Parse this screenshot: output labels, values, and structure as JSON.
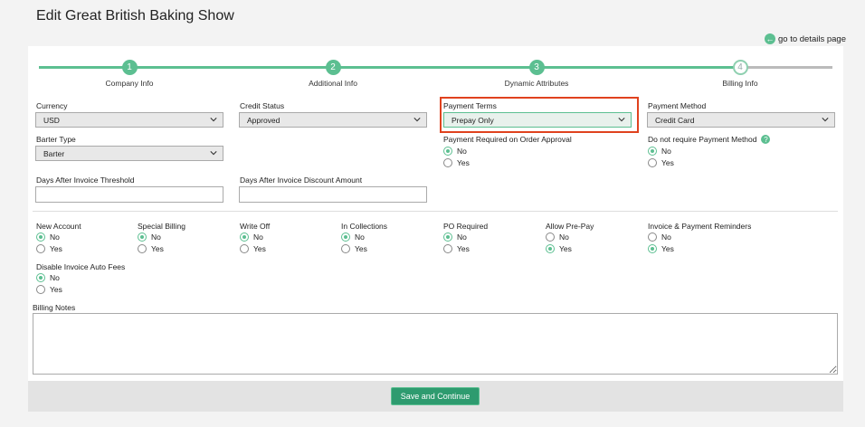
{
  "page_title": "Edit Great British Baking Show",
  "details_link": "go to details page",
  "steps": [
    {
      "number": "1",
      "label": "Company Info",
      "done": true
    },
    {
      "number": "2",
      "label": "Additional Info",
      "done": true
    },
    {
      "number": "3",
      "label": "Dynamic Attributes",
      "done": true
    },
    {
      "number": "4",
      "label": "Billing Info",
      "done": false
    }
  ],
  "fields": {
    "currency": {
      "label": "Currency",
      "value": "USD"
    },
    "credit_status": {
      "label": "Credit Status",
      "value": "Approved"
    },
    "payment_terms": {
      "label": "Payment Terms",
      "value": "Prepay Only"
    },
    "payment_method": {
      "label": "Payment Method",
      "value": "Credit Card"
    },
    "barter_type": {
      "label": "Barter Type",
      "value": "Barter"
    },
    "payment_required": {
      "label": "Payment Required on Order Approval"
    },
    "no_payment_method": {
      "label": "Do not require Payment Method"
    },
    "days_threshold": {
      "label": "Days After Invoice Threshold",
      "value": ""
    },
    "days_discount": {
      "label": "Days After Invoice Discount Amount",
      "value": ""
    }
  },
  "radio_groups": {
    "payment_required": {
      "selected": "No"
    },
    "no_payment_method": {
      "selected": "No"
    },
    "new_account": {
      "label": "New Account",
      "selected": "No"
    },
    "special_billing": {
      "label": "Special Billing",
      "selected": "No"
    },
    "write_off": {
      "label": "Write Off",
      "selected": "No"
    },
    "in_collections": {
      "label": "In Collections",
      "selected": "No"
    },
    "po_required": {
      "label": "PO Required",
      "selected": "No"
    },
    "allow_prepay": {
      "label": "Allow Pre-Pay",
      "selected": "Yes"
    },
    "reminders": {
      "label": "Invoice & Payment Reminders",
      "selected": "Yes"
    },
    "disable_auto_fees": {
      "label": "Disable Invoice Auto Fees",
      "selected": "No"
    }
  },
  "options": {
    "no": "No",
    "yes": "Yes"
  },
  "billing_notes": {
    "label": "Billing Notes",
    "value": ""
  },
  "save_button": "Save and Continue",
  "colors": {
    "accent": "#5cbf91",
    "button": "#2e9b6f",
    "highlight": "#e0421e"
  }
}
